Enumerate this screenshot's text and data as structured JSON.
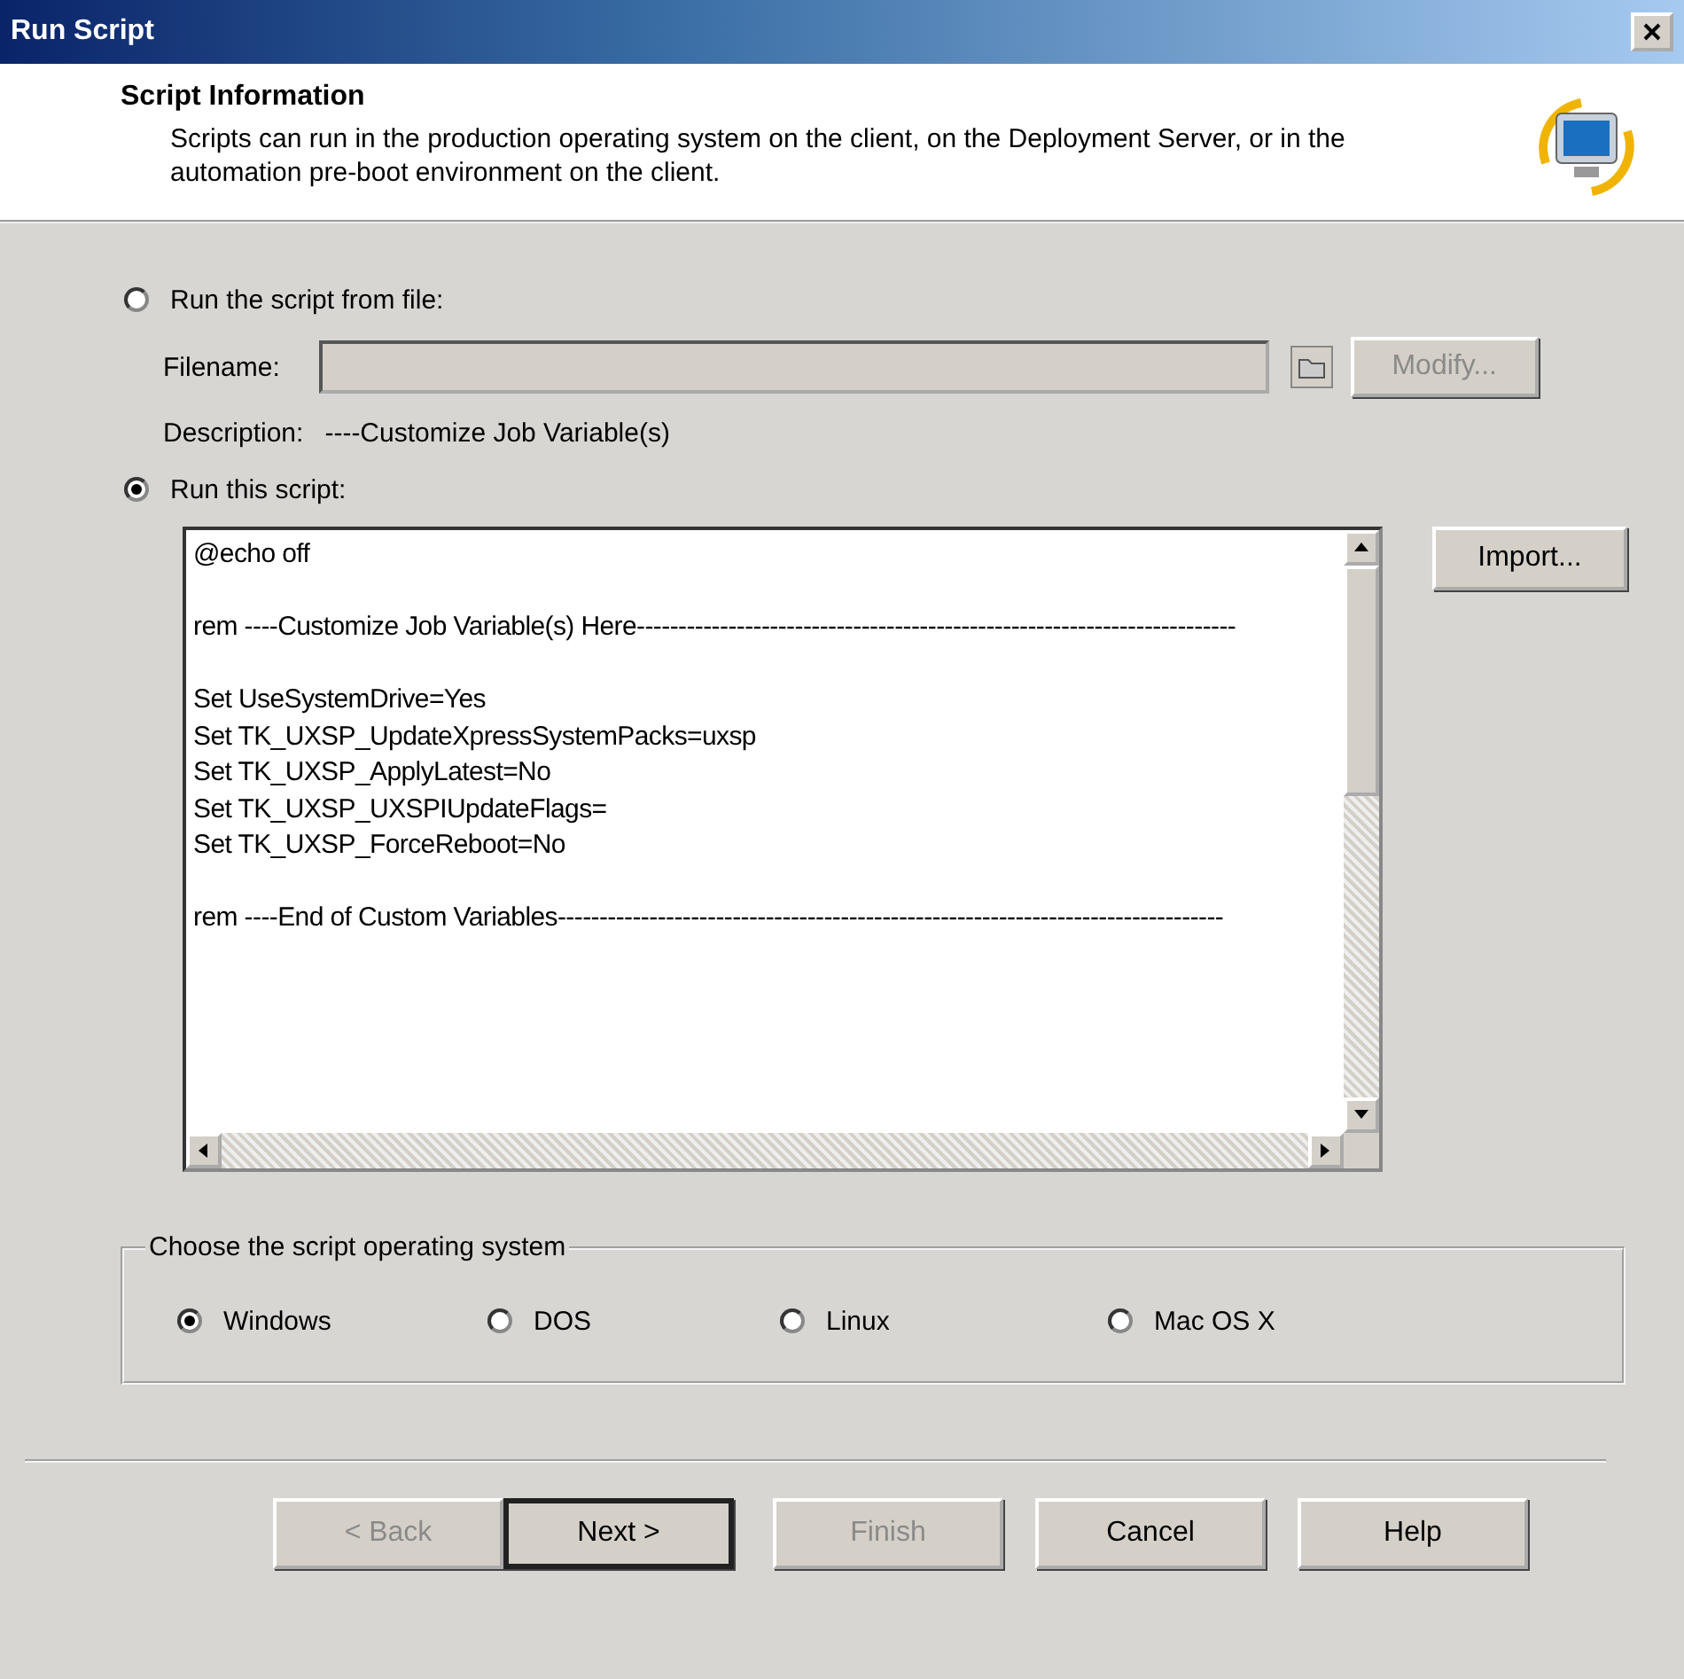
{
  "window": {
    "title": "Run Script"
  },
  "header": {
    "title": "Script Information",
    "description": "Scripts can run in the production operating system on the client, on the Deployment Server, or in the automation pre-boot environment on the client."
  },
  "source_options": [
    {
      "label": "Run the script from file:",
      "selected": false
    },
    {
      "label": "Run this script:",
      "selected": true
    }
  ],
  "file": {
    "label": "Filename:",
    "disabled": true,
    "modify_button": {
      "label": "Modify...",
      "disabled": true
    },
    "description_label": "Description:",
    "description_value": "----Customize Job Variable(s)"
  },
  "script": {
    "blocks": [
      [
        "@echo off"
      ],
      [
        "rem ----Customize Job Variable(s) Here------------------------------------------------------------------------"
      ],
      [
        "Set UseSystemDrive=Yes",
        "Set TK_UXSP_UpdateXpressSystemPacks=uxsp",
        "Set TK_UXSP_ApplyLatest=No",
        "Set TK_UXSP_UXSPIUpdateFlags=",
        "Set TK_UXSP_ForceReboot=No"
      ],
      [
        "rem ----End of Custom Variables--------------------------------------------------------------------------------"
      ]
    ],
    "import_button": "Import..."
  },
  "os_group": {
    "title": "Choose the script operating  system",
    "options": [
      {
        "label": "Windows",
        "selected": true
      },
      {
        "label": "DOS",
        "selected": false
      },
      {
        "label": "Linux",
        "selected": false
      },
      {
        "label": "Mac OS X",
        "selected": false
      }
    ]
  },
  "buttons": [
    {
      "label": "< Back",
      "disabled": true,
      "default": false
    },
    {
      "label": "Next >",
      "disabled": false,
      "default": true
    },
    {
      "label": "Finish",
      "disabled": true,
      "default": false
    },
    {
      "label": "Cancel",
      "disabled": false,
      "default": false
    },
    {
      "label": "Help",
      "disabled": false,
      "default": false
    }
  ]
}
